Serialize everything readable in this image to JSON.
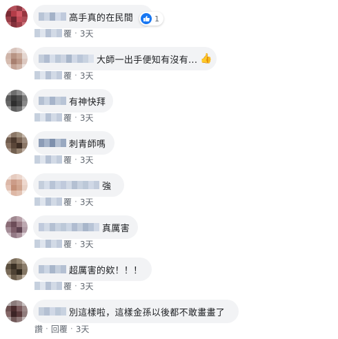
{
  "comments": [
    {
      "text": "高手真的在民間",
      "reply_label": "覆",
      "time": "3天",
      "reaction_count": "1"
    },
    {
      "text": "大師一出手便知有沒有...",
      "reply_label": "覆",
      "time": "3天"
    },
    {
      "text": "有神快拜",
      "reply_label": "覆",
      "time": "3天"
    },
    {
      "text": "刺青師嗎",
      "reply_label": "覆",
      "time": "3天"
    },
    {
      "text": "強",
      "reply_label": "覆",
      "time": "3天"
    },
    {
      "text": "真厲害",
      "reply_label": "覆",
      "time": "3天"
    },
    {
      "text": "超厲害的欸！！！",
      "reply_label": "覆",
      "time": "3天"
    },
    {
      "text": "別這樣啦，這樣金孫以後都不敢畫畫了",
      "like_label": "讚",
      "reply_label": "回覆",
      "time": "3天"
    }
  ],
  "colors": {
    "bubble_bg": "#f2f3f5",
    "text": "#1c1e21",
    "meta_text": "#606770",
    "like_blue": "#1877f2"
  },
  "icons": {
    "reaction": "thumbs-up-icon",
    "emoji": "thumbs-up-emoji-icon"
  }
}
